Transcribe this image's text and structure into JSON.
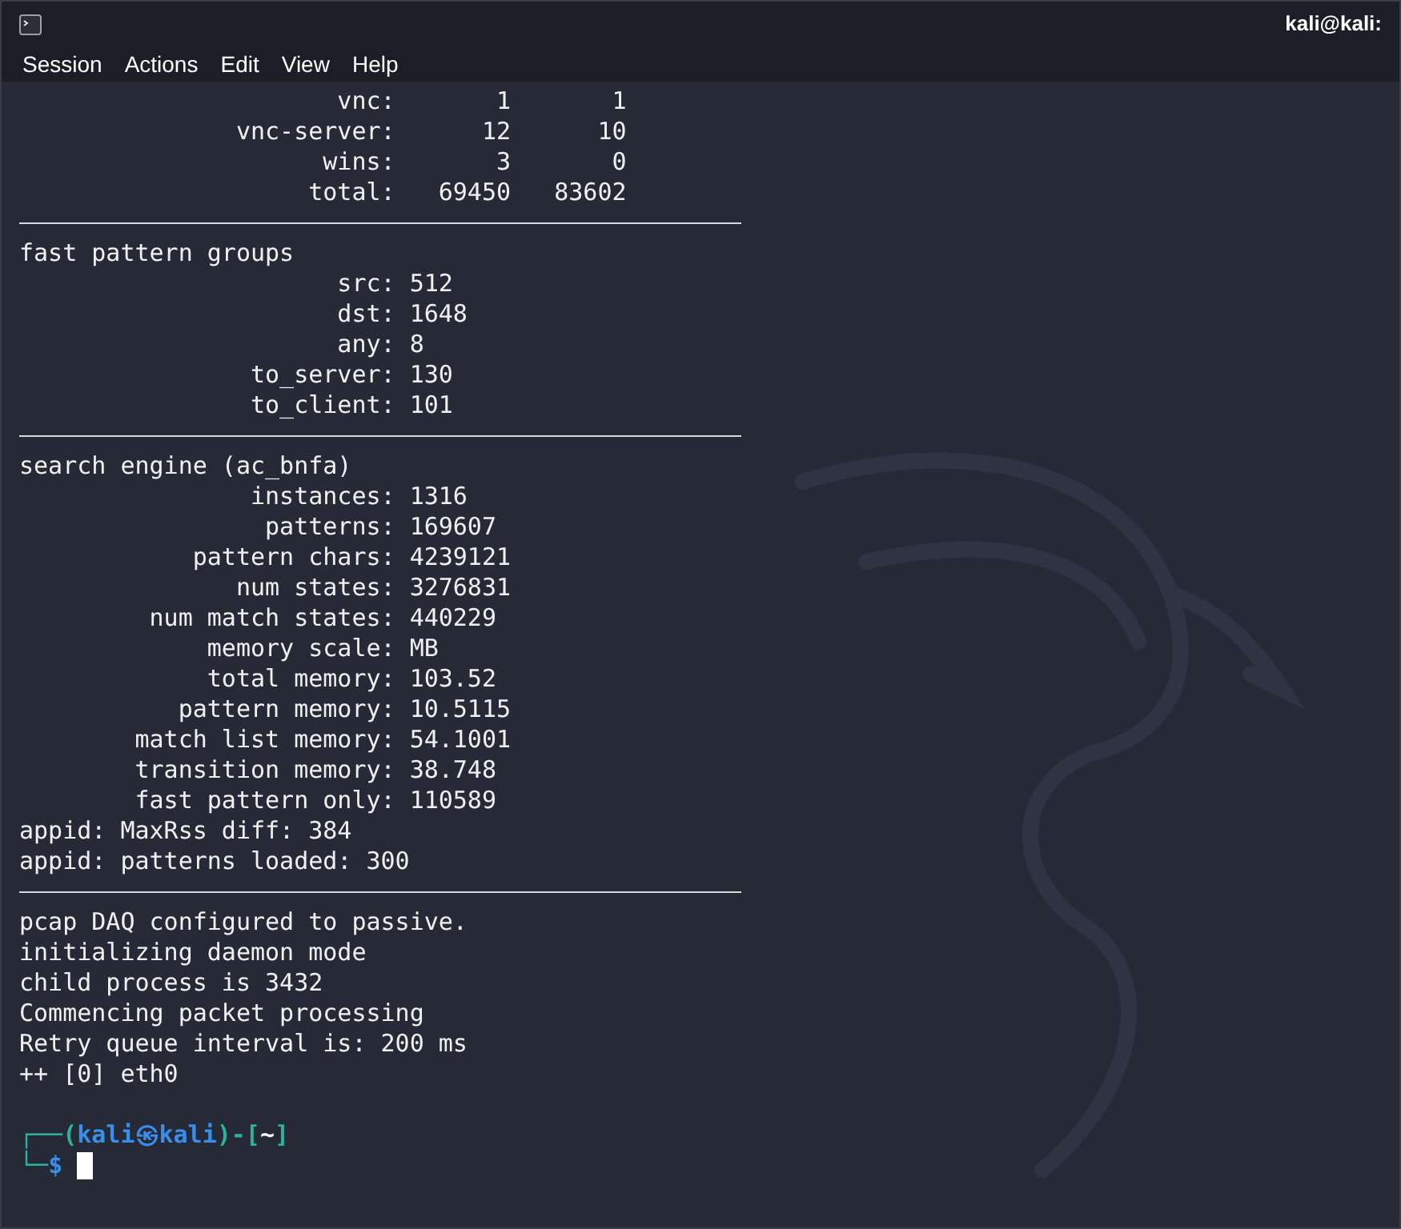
{
  "window": {
    "title": "kali@kali:"
  },
  "menu": [
    "Session",
    "Actions",
    "Edit",
    "View",
    "Help"
  ],
  "counts": [
    {
      "label": "vnc:",
      "values": [
        "1",
        "1"
      ]
    },
    {
      "label": "vnc-server:",
      "values": [
        "12",
        "10"
      ]
    },
    {
      "label": "wins:",
      "values": [
        "3",
        "0"
      ]
    },
    {
      "label": "total:",
      "values": [
        "69450",
        "83602"
      ]
    }
  ],
  "sections": [
    {
      "heading": "fast pattern groups",
      "rows": [
        {
          "label": "src:",
          "value": "512"
        },
        {
          "label": "dst:",
          "value": "1648"
        },
        {
          "label": "any:",
          "value": "8"
        },
        {
          "label": "to_server:",
          "value": "130"
        },
        {
          "label": "to_client:",
          "value": "101"
        }
      ]
    },
    {
      "heading": "search engine (ac_bnfa)",
      "rows": [
        {
          "label": "instances:",
          "value": "1316"
        },
        {
          "label": "patterns:",
          "value": "169607"
        },
        {
          "label": "pattern chars:",
          "value": "4239121"
        },
        {
          "label": "num states:",
          "value": "3276831"
        },
        {
          "label": "num match states:",
          "value": "440229"
        },
        {
          "label": "memory scale:",
          "value": "MB"
        },
        {
          "label": "total memory:",
          "value": "103.52"
        },
        {
          "label": "pattern memory:",
          "value": "10.5115"
        },
        {
          "label": "match list memory:",
          "value": "54.1001"
        },
        {
          "label": "transition memory:",
          "value": "38.748"
        },
        {
          "label": "fast pattern only:",
          "value": "110589"
        }
      ],
      "lines": [
        "appid: MaxRss diff: 384",
        "appid: patterns loaded: 300"
      ]
    }
  ],
  "output": [
    "pcap DAQ configured to passive.",
    "initializing daemon mode",
    "child process is 3432",
    "Commencing packet processing",
    "Retry queue interval is: 200 ms",
    "++ [0] eth0"
  ],
  "prompt": {
    "corner_top": "┌──(",
    "user": "kali",
    "at": "㉿",
    "host": "kali",
    "mid": ")-[",
    "path": "~",
    "close": "]",
    "corner_bottom": "└─",
    "symbol": "$"
  }
}
